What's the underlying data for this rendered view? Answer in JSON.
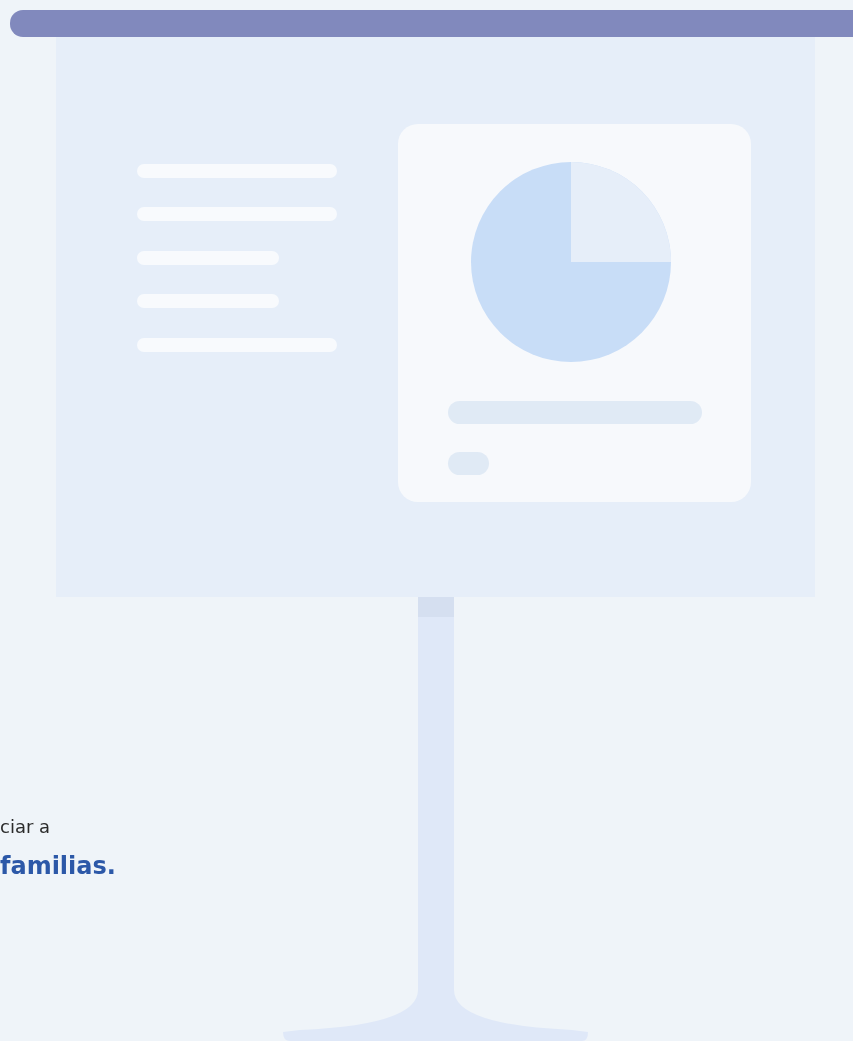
{
  "paragraph": [
    {
      "text": "ciar a",
      "kind": "plain"
    },
    {
      "text": "familias.",
      "kind": "emphasis"
    }
  ]
}
